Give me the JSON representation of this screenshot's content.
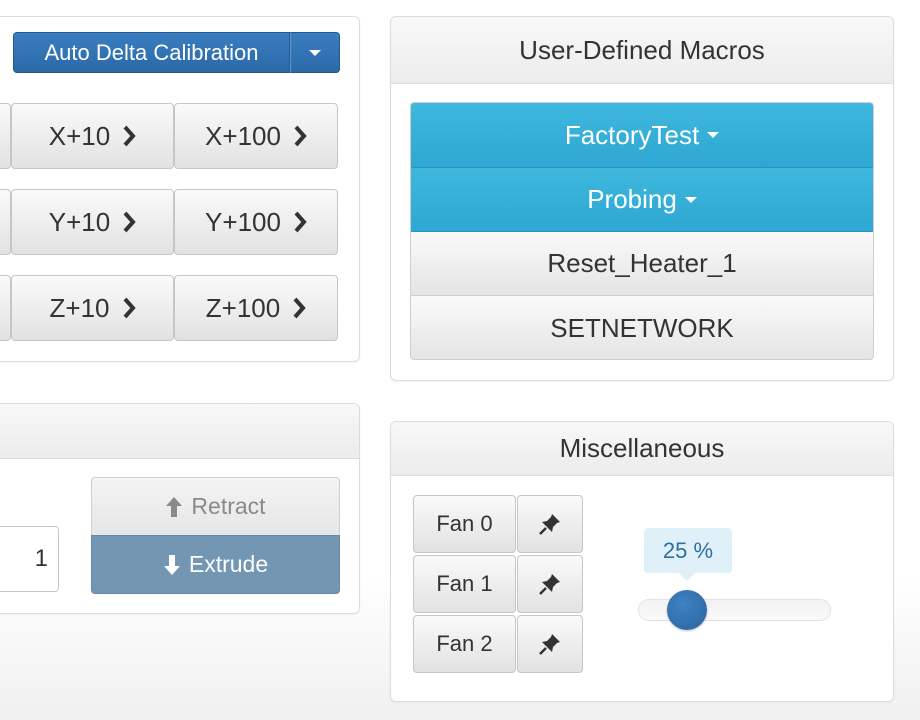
{
  "movement": {
    "calibration_button": "Auto Delta Calibration",
    "rows": [
      {
        "axis": "x",
        "plus10": "X+10",
        "plus100": "X+100"
      },
      {
        "axis": "y",
        "plus10": "Y+10",
        "plus100": "Y+100"
      },
      {
        "axis": "z",
        "plus10": "Z+10",
        "plus100": "Z+100"
      }
    ]
  },
  "extruder": {
    "amount_fragment": "1",
    "retract_label": "Retract",
    "extrude_label": "Extrude"
  },
  "macros": {
    "title": "User-Defined Macros",
    "items": [
      {
        "label": "FactoryTest",
        "style": "blue",
        "has_menu": true
      },
      {
        "label": "Probing",
        "style": "blue",
        "has_menu": true
      },
      {
        "label": "Reset_Heater_1",
        "style": "gray",
        "has_menu": false
      },
      {
        "label": "SETNETWORK",
        "style": "gray",
        "has_menu": false
      }
    ]
  },
  "misc": {
    "title": "Miscellaneous",
    "fans": [
      {
        "label": "Fan 0"
      },
      {
        "label": "Fan 1"
      },
      {
        "label": "Fan 2"
      }
    ],
    "slider_tooltip": "25 %",
    "slider_value_percent": 25
  },
  "colors": {
    "primary": "#2f6fae",
    "macro_blue": "#35afda",
    "extrude_active": "#7396b3",
    "slider_handle": "#2f6ca8"
  }
}
